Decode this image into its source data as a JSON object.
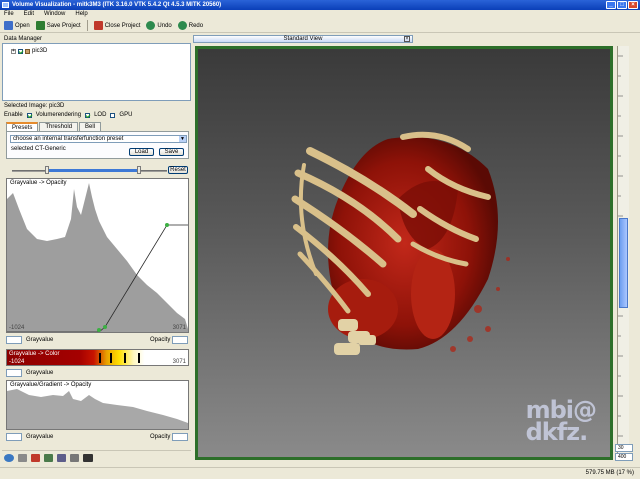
{
  "window": {
    "title": "Volume Visualization - mitk3M3 (ITK 3.16.0  VTK 5.4.2 Qt 4.5.3 MITK 20560)",
    "buttons": [
      "_",
      "□",
      "×"
    ]
  },
  "menu": [
    "File",
    "Edit",
    "Window",
    "Help"
  ],
  "toolbar": [
    {
      "label": "Open",
      "icon": "open-icon",
      "color": "#3f6fc9"
    },
    {
      "label": "Save Project",
      "icon": "save-project-icon",
      "color": "#2e7d32"
    },
    {
      "label": "Close Project",
      "icon": "close-project-icon",
      "color": "#c0392b"
    },
    {
      "label": "Undo",
      "icon": "undo-icon",
      "color": "#2d8a4e"
    },
    {
      "label": "Redo",
      "icon": "redo-icon",
      "color": "#2d8a4e"
    }
  ],
  "data_manager": {
    "title": "Data Manager",
    "node_label": "pic3D"
  },
  "volume": {
    "selected_image": "Selected Image: pic3D",
    "enable_label": "Enable",
    "volume_rendering_label": "Volumerendering",
    "lod_label": "LOD",
    "gpu_label": "GPU",
    "tabs": [
      "Presets",
      "Threshold",
      "Bell"
    ],
    "preset_placeholder": "choose an internal transferfunction preset",
    "selected_preset": "selected CT-Generic",
    "load_label": "Load",
    "save_label": "Save",
    "reset_label": "Reset"
  },
  "opacity_panel": {
    "title": "Grayvalue -> Opacity",
    "min_label": "-1024",
    "max_label": "3071",
    "gray_label": "Grayvalue",
    "opacity_label": "Opacity"
  },
  "color_panel": {
    "title": "Grayvalue -> Color",
    "min_label": "-1024",
    "max_label": "3071",
    "gray_label": "Grayvalue"
  },
  "gradient_panel": {
    "title": "Grayvalue/Gradient -> Opacity",
    "gray_label": "Grayvalue",
    "opacity_label": "Opacity"
  },
  "view": {
    "tab_label": "Standard View",
    "logo_line1": "mbi@",
    "logo_line2": "dkfz."
  },
  "ruler_fields": [
    "30",
    "400"
  ],
  "status": {
    "memory": "579.75 MB (17 %)"
  },
  "colors": {
    "title_bar": "#0a3fb8",
    "viewport_border": "#2d6f2a",
    "accent": "#3e79d6"
  }
}
